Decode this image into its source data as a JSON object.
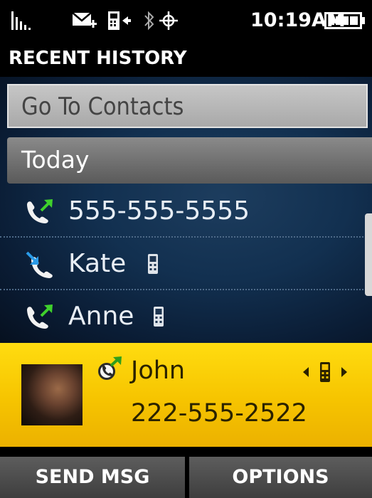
{
  "status_bar": {
    "time": "10:19AM",
    "icons": [
      "signal-icon",
      "message-icon",
      "phone-signal-icon",
      "bluetooth-icon",
      "gps-icon",
      "battery-icon"
    ]
  },
  "header": {
    "title": "RECENT HISTORY"
  },
  "list": {
    "go_to_contacts": "Go To Contacts",
    "section_header": "Today",
    "entries": [
      {
        "label": "555-555-5555",
        "call_type": "outgoing",
        "mobile": false
      },
      {
        "label": "Kate",
        "call_type": "incoming",
        "mobile": true
      },
      {
        "label": "Anne",
        "call_type": "outgoing",
        "mobile": true
      }
    ]
  },
  "selected_entry": {
    "name": "John",
    "number": "222-555-2522",
    "call_type": "video-outgoing"
  },
  "soft_keys": {
    "left": "SEND MSG",
    "right": "OPTIONS"
  },
  "colors": {
    "highlight": "#f6c400",
    "outgoing_arrow": "#3fd12c",
    "incoming_arrow": "#2a9be8",
    "list_background": "#123050"
  }
}
